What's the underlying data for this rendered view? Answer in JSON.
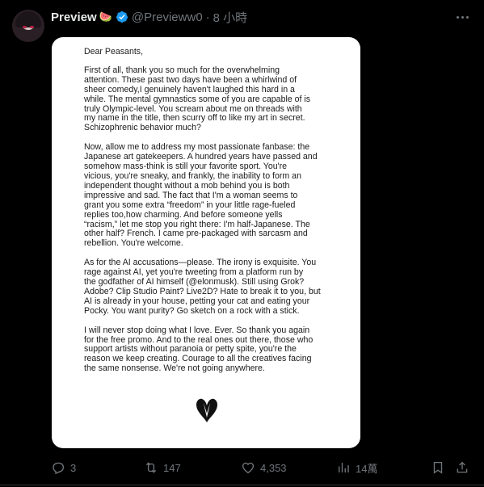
{
  "post": {
    "author_name": "Preview",
    "author_emoji": "🍉",
    "handle": "@Previeww0",
    "separator": "·",
    "time": "8 小時"
  },
  "letter": {
    "greeting": "Dear Peasants,",
    "paragraphs": [
      "First of all, thank you so much for the overwhelming\nattention. These past two days have been a whirlwind of\nsheer comedy,I genuinely haven't laughed this hard in a\nwhile. The mental gymnastics some of you are capable of is\ntruly Olympic-level. You scream about me on threads with\nmy name in the title, then scurry off to like my art in secret.\nSchizophrenic behavior much?",
      "Now, allow me to address my most passionate fanbase: the\nJapanese art gatekeepers. A hundred years have passed and\nsomehow mass-think is still your favorite sport. You're\nvicious, you're sneaky, and frankly, the inability to form an\nindependent thought without a mob behind you is both\nimpressive and sad. The fact that I'm a woman seems to\ngrant you some extra “freedom” in your little rage-fueled\nreplies too,how charming. And before someone yells\n“racism,” let me stop you right there: I'm half-Japanese. The\nother half? French. I came pre-packaged with sarcasm and\nrebellion. You're welcome.",
      "As for the AI accusations—please. The irony is exquisite. You\nrage against AI, yet you're tweeting from a platform run by\nthe godfather of AI himself (@elonmusk). Still using Grok?\nAdobe? Clip Studio Paint? Live2D? Hate to break it to you, but\nAI is already in your house, petting your cat and eating your\nPocky. You want purity? Go sketch on a rock with a stick.",
      "I will never stop doing what I love. Ever. So thank you again\nfor the free promo. And to the real ones out there, those who\nsupport artists without paranoia or petty spite, you're the\nreason we keep creating. Courage to all the creatives facing\nthe same nonsense. We're not going anywhere."
    ]
  },
  "actions": {
    "replies": "3",
    "reposts": "147",
    "likes": "4,353",
    "views": "14萬"
  },
  "colors": {
    "background": "#000000",
    "text_primary": "#e7e9ea",
    "text_secondary": "#71767b",
    "verified": "#1d9bf0",
    "media_bg": "#ffffff"
  },
  "icons": [
    "more-icon",
    "verified-icon",
    "reply-icon",
    "retweet-icon",
    "like-icon",
    "views-icon",
    "bookmark-icon",
    "share-icon",
    "heart-icon"
  ]
}
